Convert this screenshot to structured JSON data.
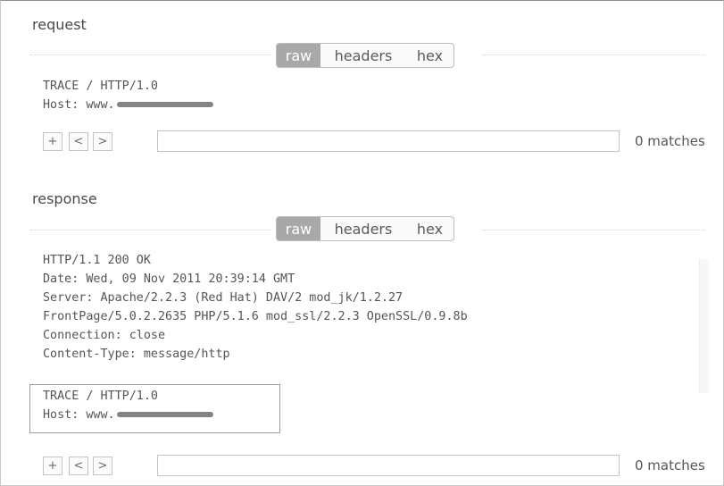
{
  "request": {
    "title": "request",
    "tabs": {
      "raw": "raw",
      "headers": "headers",
      "hex": "hex",
      "active": "raw"
    },
    "lines": [
      "TRACE / HTTP/1.0",
      "Host: www."
    ],
    "nav": {
      "add": "+",
      "prev": "<",
      "next": ">"
    },
    "search_value": "",
    "matches": "0 matches"
  },
  "response": {
    "title": "response",
    "tabs": {
      "raw": "raw",
      "headers": "headers",
      "hex": "hex",
      "active": "raw"
    },
    "lines": [
      "HTTP/1.1 200 OK",
      "Date: Wed, 09 Nov 2011 20:39:14 GMT",
      "Server: Apache/2.2.3 (Red Hat) DAV/2 mod_jk/1.2.27",
      "FrontPage/5.0.2.2635 PHP/5.1.6 mod_ssl/2.2.3 OpenSSL/0.9.8b",
      "Connection: close",
      "Content-Type: message/http"
    ],
    "body_lines": [
      "TRACE / HTTP/1.0",
      "Host: www."
    ],
    "nav": {
      "add": "+",
      "prev": "<",
      "next": ">"
    },
    "search_value": "",
    "matches": "0 matches"
  },
  "icons": {
    "redaction": "redaction-bar"
  }
}
